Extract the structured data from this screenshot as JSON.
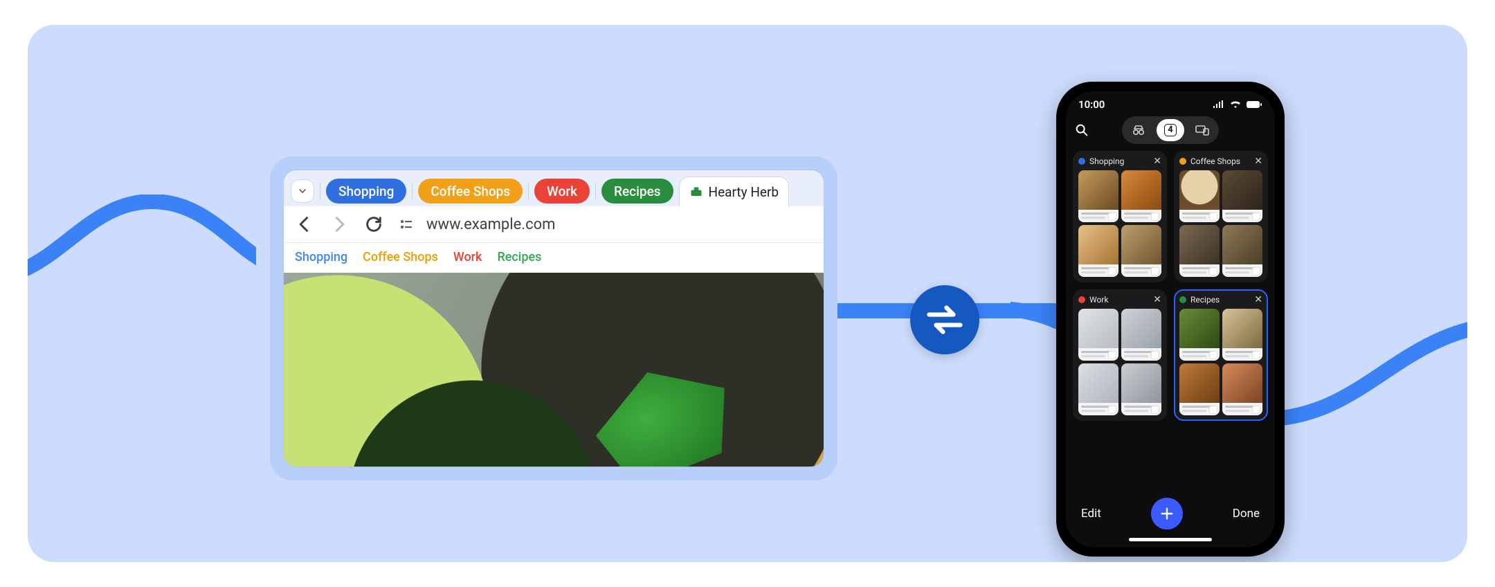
{
  "colors": {
    "shopping": "#2f6fe0",
    "coffee": "#f3a019",
    "work": "#ea4336",
    "recipes": "#2a8c3f"
  },
  "desktop": {
    "tab_groups": [
      {
        "label": "Shopping",
        "color_key": "shopping"
      },
      {
        "label": "Coffee Shops",
        "color_key": "coffee"
      },
      {
        "label": "Work",
        "color_key": "work"
      },
      {
        "label": "Recipes",
        "color_key": "recipes"
      }
    ],
    "active_tab": {
      "title": "Hearty Herb"
    },
    "url": "www.example.com",
    "bookmark_bar": [
      {
        "label": "Shopping",
        "class": "blue"
      },
      {
        "label": "Coffee Shops",
        "class": "yellow"
      },
      {
        "label": "Work",
        "class": "red"
      },
      {
        "label": "Recipes",
        "class": "green"
      }
    ]
  },
  "phone": {
    "time": "10:00",
    "segmented_count": "4",
    "groups": [
      {
        "label": "Shopping",
        "color": "#2f6fe0",
        "selected": false
      },
      {
        "label": "Coffee Shops",
        "color": "#f3a019",
        "selected": false
      },
      {
        "label": "Work",
        "color": "#ea4336",
        "selected": false
      },
      {
        "label": "Recipes",
        "color": "#2a8c3f",
        "selected": true
      }
    ],
    "edit_label": "Edit",
    "done_label": "Done"
  }
}
